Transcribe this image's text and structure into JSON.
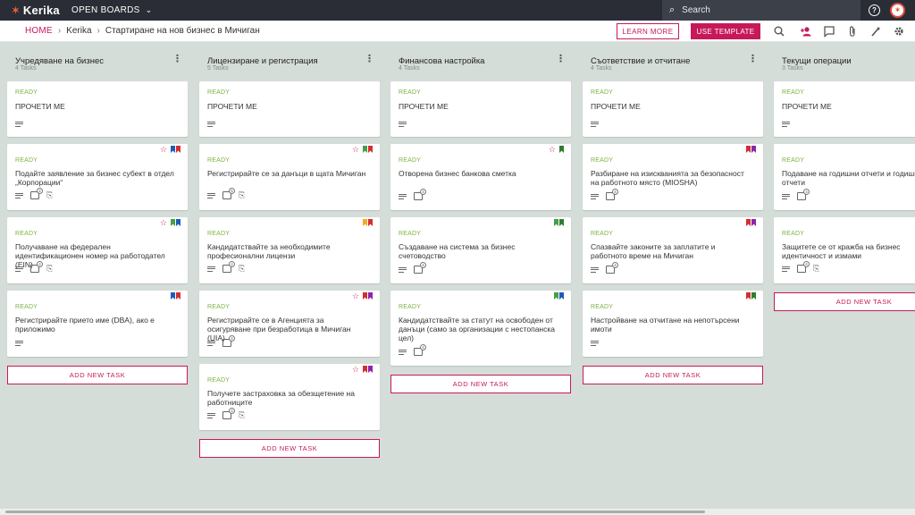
{
  "app": {
    "logo": "Kerika",
    "open_boards": "OPEN BOARDS",
    "search_placeholder": "Search"
  },
  "breadcrumb": {
    "home": "HOME",
    "org": "Kerika",
    "board": "Стартиране на нов бизнес в Мичиган"
  },
  "toolbar": {
    "learn_more": "LEARN MORE",
    "use_template": "USE TEMPLATE",
    "icons": [
      "search-icon",
      "add-person-icon",
      "chat-icon",
      "attachment-icon",
      "magic-wand-icon",
      "gear-icon"
    ]
  },
  "colors": {
    "brand": "#c7195a",
    "ready": "#7cb342",
    "topbar": "#2a2d35",
    "board_bg": "#d5ddd9"
  },
  "columns": [
    {
      "title": "Учредяване на бизнес",
      "count": "4 Tasks",
      "add_task": "ADD NEW TASK",
      "cards": [
        {
          "status": "READY",
          "title": "ПРОЧЕТИ МЕ",
          "check": "",
          "attach": false,
          "star": false,
          "flags": []
        },
        {
          "status": "READY",
          "title": "Подайте заявление за бизнес субект в отдел „Корпорации“",
          "check": "2",
          "attach": true,
          "star": true,
          "flags": [
            "#1e5bb8",
            "#d32f2f"
          ]
        },
        {
          "status": "READY",
          "title": "Получаване на федерален идентификационен номер на работодател (EIN)",
          "check": "4",
          "attach": true,
          "star": true,
          "flags": [
            "#43a047",
            "#1e5bb8"
          ]
        },
        {
          "status": "READY",
          "title": "Регистрирайте прието име (DBA), ако е приложимо",
          "check": "",
          "attach": false,
          "star": false,
          "flags": [
            "#1e5bb8",
            "#d32f2f"
          ]
        }
      ]
    },
    {
      "title": "Лицензиране и регистрация",
      "count": "5 Tasks",
      "add_task": "ADD NEW TASK",
      "cards": [
        {
          "status": "READY",
          "title": "ПРОЧЕТИ МЕ",
          "check": "",
          "attach": false,
          "star": false,
          "flags": []
        },
        {
          "status": "READY",
          "title": "Регистрирайте се за данъци в щата Мичиган",
          "check": "5",
          "attach": true,
          "star": true,
          "flags": [
            "#43a047",
            "#d32f2f"
          ]
        },
        {
          "status": "READY",
          "title": "Кандидатствайте за необходимите професионални лицензи",
          "check": "4",
          "attach": true,
          "star": false,
          "flags": [
            "#f9a825",
            "#d32f2f"
          ]
        },
        {
          "status": "READY",
          "title": "Регистрирайте се в Агенцията за осигуряване при безработица в Мичиган (UIA)",
          "check": "4",
          "attach": false,
          "star": true,
          "flags": [
            "#d32f2f",
            "#8e24aa"
          ]
        },
        {
          "status": "READY",
          "title": "Получете застраховка за обезщетение на работниците",
          "check": "4",
          "attach": true,
          "star": true,
          "flags": [
            "#d32f2f",
            "#8e24aa"
          ]
        }
      ]
    },
    {
      "title": "Финансова настройка",
      "count": "4 Tasks",
      "add_task": "ADD NEW TASK",
      "cards": [
        {
          "status": "READY",
          "title": "ПРОЧЕТИ МЕ",
          "check": "",
          "attach": false,
          "star": false,
          "flags": []
        },
        {
          "status": "READY",
          "title": "Отворена бизнес банкова сметка",
          "check": "4",
          "attach": false,
          "star": true,
          "flags": [
            "#2e7d32"
          ]
        },
        {
          "status": "READY",
          "title": "Създаване на система за бизнес счетоводство",
          "check": "4",
          "attach": false,
          "star": false,
          "flags": [
            "#43a047",
            "#2e7d32"
          ]
        },
        {
          "status": "READY",
          "title": "Кандидатствайте за статут на освободен от данъци (само за организации с нестопанска цел)",
          "check": "4",
          "attach": false,
          "star": false,
          "flags": [
            "#43a047",
            "#1e5bb8"
          ]
        }
      ]
    },
    {
      "title": "Съответствие и отчитане",
      "count": "4 Tasks",
      "add_task": "ADD NEW TASK",
      "cards": [
        {
          "status": "READY",
          "title": "ПРОЧЕТИ МЕ",
          "check": "",
          "attach": false,
          "star": false,
          "flags": []
        },
        {
          "status": "READY",
          "title": "Разбиране на изискванията за безопасност на работното място (MIOSHA)",
          "check": "4",
          "attach": false,
          "star": false,
          "flags": [
            "#d32f2f",
            "#8e24aa"
          ]
        },
        {
          "status": "READY",
          "title": "Спазвайте законите за заплатите и работното време на Мичиган",
          "check": "4",
          "attach": false,
          "star": false,
          "flags": [
            "#d32f2f",
            "#8e24aa"
          ]
        },
        {
          "status": "READY",
          "title": "Настройване на отчитане на непотърсени имоти",
          "check": "",
          "attach": false,
          "star": false,
          "flags": [
            "#d32f2f",
            "#2e7d32"
          ]
        }
      ]
    },
    {
      "title": "Текущи операции",
      "count": "3 Tasks",
      "add_task": "ADD NEW TASK",
      "cards": [
        {
          "status": "READY",
          "title": "ПРОЧЕТИ МЕ",
          "check": "",
          "attach": false,
          "star": false,
          "flags": []
        },
        {
          "status": "READY",
          "title": "Подаване на годишни отчети и годишни отчети",
          "check": "4",
          "attach": false,
          "star": false,
          "flags": []
        },
        {
          "status": "READY",
          "title": "Защитете се от кражба на бизнес идентичност и измами",
          "check": "4",
          "attach": true,
          "star": false,
          "flags": []
        }
      ]
    }
  ]
}
